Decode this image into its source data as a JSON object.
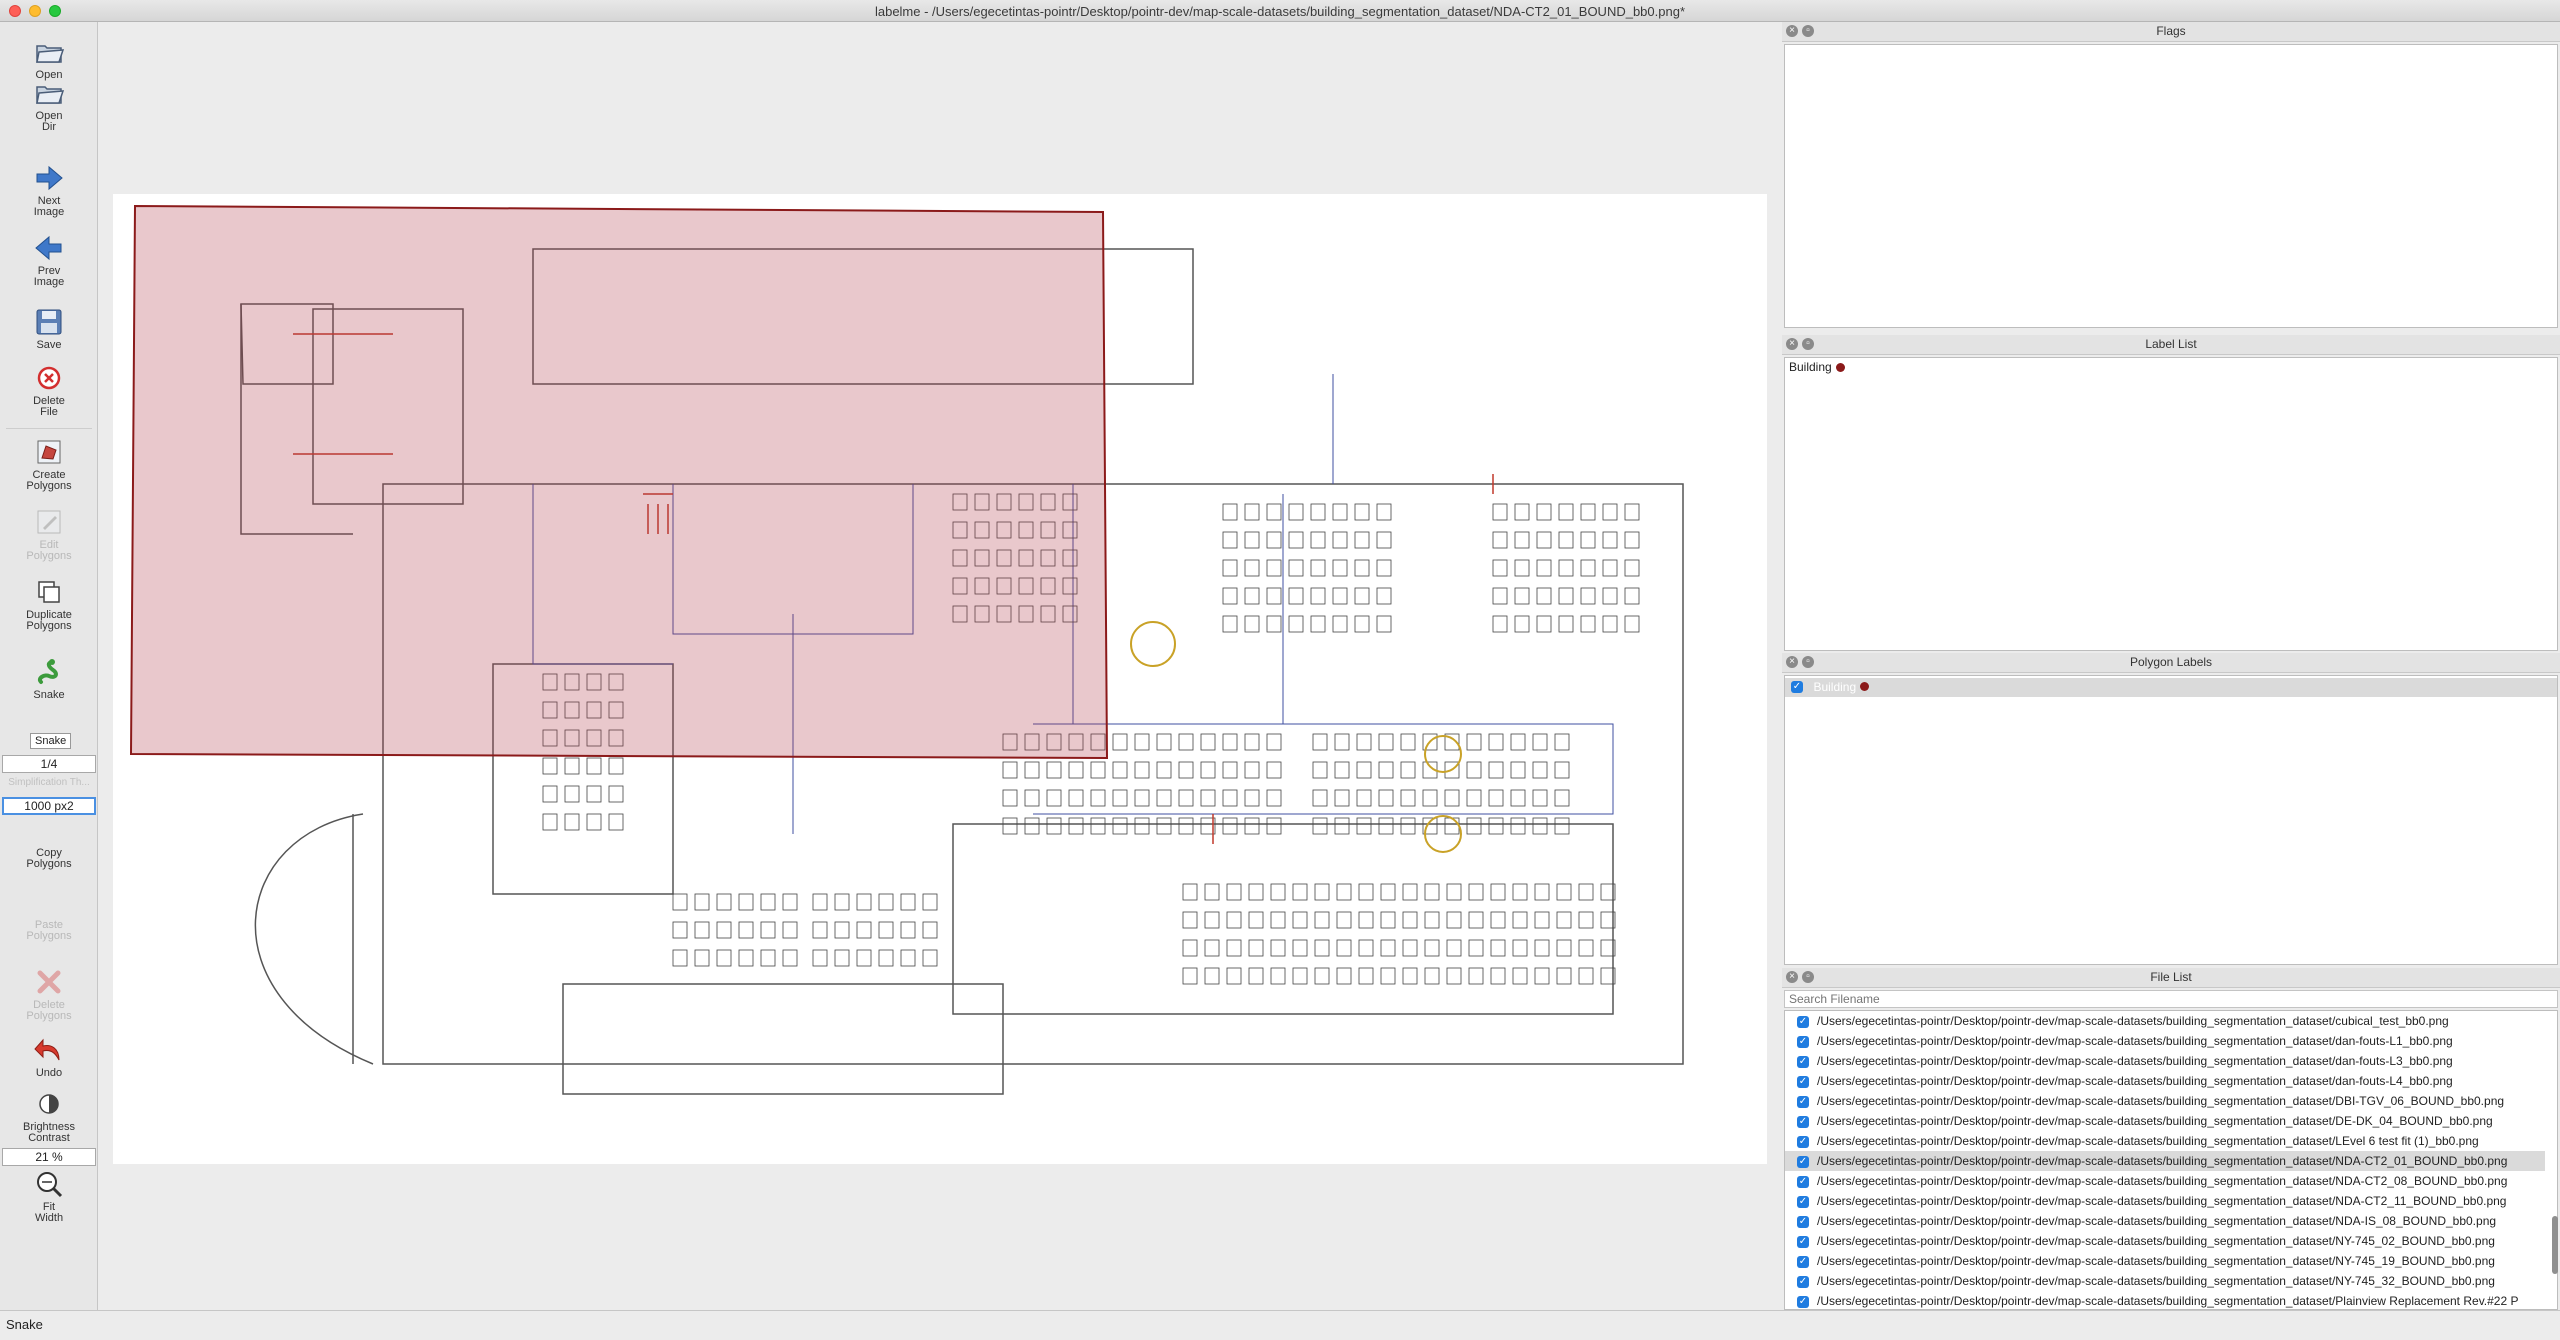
{
  "window": {
    "title": "labelme - /Users/egecetintas-pointr/Desktop/pointr-dev/map-scale-datasets/building_segmentation_dataset/NDA-CT2_01_BOUND_bb0.png*"
  },
  "toolbar": {
    "open": "Open",
    "open_dir": "Open\nDir",
    "next_image": "Next\nImage",
    "prev_image": "Prev\nImage",
    "save": "Save",
    "delete_file": "Delete\nFile",
    "create_polygons": "Create\nPolygons",
    "edit_polygons": "Edit\nPolygons",
    "duplicate_polygons": "Duplicate\nPolygons",
    "snake": "Snake",
    "snake_tooltip": "Snake",
    "epsilon_value": "1/4",
    "simplification_label": "Simplification Th...",
    "simplification_value": "1000 px2",
    "copy_polygons": "Copy\nPolygons",
    "paste_polygons": "Paste\nPolygons",
    "delete_polygons": "Delete\nPolygons",
    "undo": "Undo",
    "brightness_contrast": "Brightness\nContrast",
    "zoom": "21 %",
    "fit_width": "Fit\nWidth"
  },
  "docks": {
    "flags": {
      "title": "Flags"
    },
    "label_list": {
      "title": "Label List",
      "items": [
        {
          "label": "Building",
          "color": "#8b1a1a"
        }
      ]
    },
    "polygon_labels": {
      "title": "Polygon Labels",
      "items": [
        {
          "label": "Building",
          "checked": true,
          "color": "#8b1a1a"
        }
      ]
    },
    "file_list": {
      "title": "File List",
      "search_placeholder": "Search Filename",
      "selected_index": 7,
      "files": [
        "/Users/egecetintas-pointr/Desktop/pointr-dev/map-scale-datasets/building_segmentation_dataset/cubical_test_bb0.png",
        "/Users/egecetintas-pointr/Desktop/pointr-dev/map-scale-datasets/building_segmentation_dataset/dan-fouts-L1_bb0.png",
        "/Users/egecetintas-pointr/Desktop/pointr-dev/map-scale-datasets/building_segmentation_dataset/dan-fouts-L3_bb0.png",
        "/Users/egecetintas-pointr/Desktop/pointr-dev/map-scale-datasets/building_segmentation_dataset/dan-fouts-L4_bb0.png",
        "/Users/egecetintas-pointr/Desktop/pointr-dev/map-scale-datasets/building_segmentation_dataset/DBI-TGV_06_BOUND_bb0.png",
        "/Users/egecetintas-pointr/Desktop/pointr-dev/map-scale-datasets/building_segmentation_dataset/DE-DK_04_BOUND_bb0.png",
        "/Users/egecetintas-pointr/Desktop/pointr-dev/map-scale-datasets/building_segmentation_dataset/LEvel 6 test fit (1)_bb0.png",
        "/Users/egecetintas-pointr/Desktop/pointr-dev/map-scale-datasets/building_segmentation_dataset/NDA-CT2_01_BOUND_bb0.png",
        "/Users/egecetintas-pointr/Desktop/pointr-dev/map-scale-datasets/building_segmentation_dataset/NDA-CT2_08_BOUND_bb0.png",
        "/Users/egecetintas-pointr/Desktop/pointr-dev/map-scale-datasets/building_segmentation_dataset/NDA-CT2_11_BOUND_bb0.png",
        "/Users/egecetintas-pointr/Desktop/pointr-dev/map-scale-datasets/building_segmentation_dataset/NDA-IS_08_BOUND_bb0.png",
        "/Users/egecetintas-pointr/Desktop/pointr-dev/map-scale-datasets/building_segmentation_dataset/NY-745_02_BOUND_bb0.png",
        "/Users/egecetintas-pointr/Desktop/pointr-dev/map-scale-datasets/building_segmentation_dataset/NY-745_19_BOUND_bb0.png",
        "/Users/egecetintas-pointr/Desktop/pointr-dev/map-scale-datasets/building_segmentation_dataset/NY-745_32_BOUND_bb0.png",
        "/Users/egecetintas-pointr/Desktop/pointr-dev/map-scale-datasets/building_segmentation_dataset/Plainview Replacement Rev.#22 P"
      ]
    }
  },
  "status": {
    "text": "Snake"
  },
  "colors": {
    "polygon_fill": "#d7a6aa",
    "polygon_stroke": "#8b1a1a",
    "accent": "#1f7ce0"
  }
}
